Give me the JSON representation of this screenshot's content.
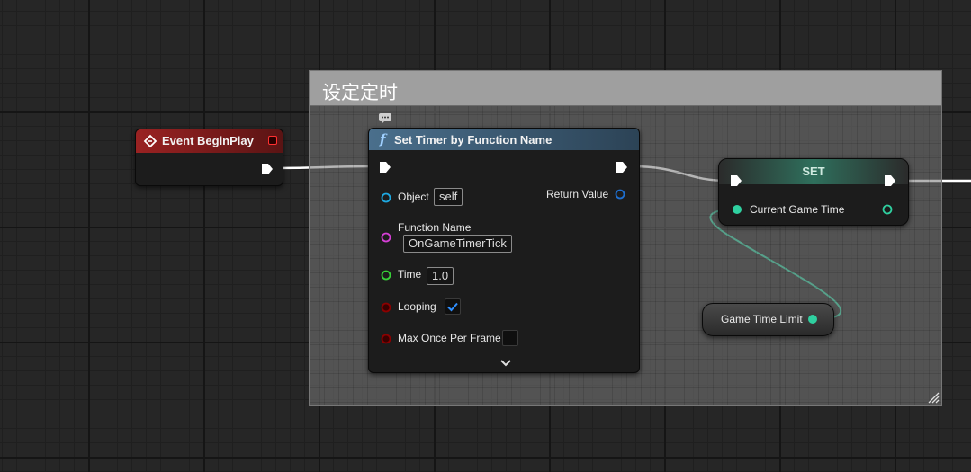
{
  "comment": {
    "title": "设定定时"
  },
  "event_node": {
    "title": "Event BeginPlay"
  },
  "timer_node": {
    "title": "Set Timer by Function Name",
    "func_glyph": "f",
    "pins": {
      "object_label": "Object",
      "object_value": "self",
      "function_name_label": "Function Name",
      "function_name_value": "OnGameTimerTick",
      "time_label": "Time",
      "time_value": "1.0",
      "looping_label": "Looping",
      "looping_checked": true,
      "max_once_label": "Max Once Per Frame",
      "max_once_checked": false,
      "return_value_label": "Return Value"
    }
  },
  "set_node": {
    "title": "SET",
    "pin_label": "Current Game Time"
  },
  "getter_node": {
    "label": "Game Time Limit"
  },
  "colors": {
    "event_header": "#8e1e1e",
    "function_header": "#3c5a72",
    "set_header": "#2d5a4c",
    "exec": "#ffffff",
    "object_pin": "#1ea8e0",
    "name_pin": "#d53fd5",
    "float_pin": "#38d138",
    "bool_pin": "#8c0000",
    "var_pin": "#2fd0a0"
  }
}
